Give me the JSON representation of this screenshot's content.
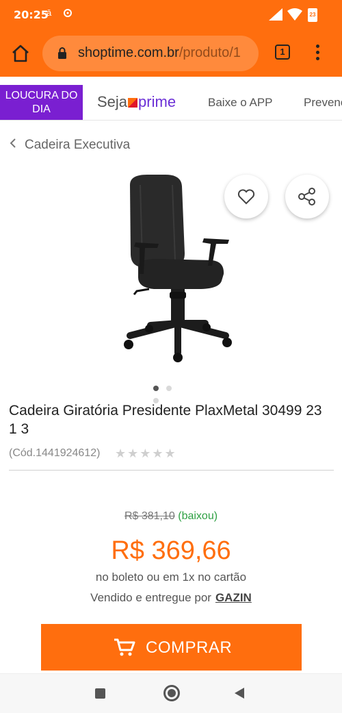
{
  "status": {
    "time": "20:25",
    "battery": "23"
  },
  "browser": {
    "url_domain": "shoptime.com.br",
    "url_path": "/produto/1",
    "tab_count": "1"
  },
  "nav": {
    "loucura_label": "LOUCURA DO DIA",
    "prime_prefix": "Seja",
    "prime_word": "prime",
    "app_label": "Baixe o APP",
    "next_label": "Prevenç"
  },
  "breadcrumb": {
    "label": "Cadeira Executiva"
  },
  "carousel": {
    "count": 3,
    "active": 0
  },
  "product": {
    "title": "Cadeira Giratória Presidente PlaxMetal 30499 23 1 3",
    "code": "(Cód.1441924612)",
    "stars": "★★★★★",
    "old_price": "R$ 381,10",
    "old_price_note": "(baixou)",
    "price": "R$ 369,66",
    "payment_info": "no boleto ou em 1x no cartão",
    "seller_prefix": "Vendido e entregue por",
    "seller_name": "GAZIN"
  },
  "buy_button": {
    "label": "COMPRAR"
  },
  "colors": {
    "brand": "#ff6e0e",
    "promo": "#7a1fd1",
    "discount": "#2ea043"
  }
}
